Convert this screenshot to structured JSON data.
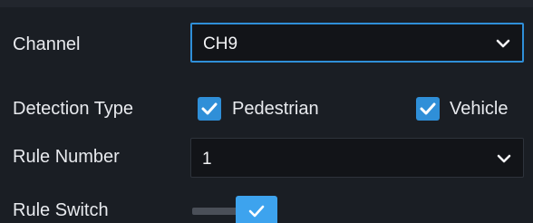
{
  "channel": {
    "label": "Channel",
    "selected_value": "CH9",
    "dropdown_icon": "chevron-down-icon"
  },
  "detection_type": {
    "label": "Detection Type",
    "options": [
      {
        "label": "Pedestrian",
        "checked": true,
        "icon": "checkmark-icon"
      },
      {
        "label": "Vehicle",
        "checked": true,
        "icon": "checkmark-icon"
      }
    ]
  },
  "rule_number": {
    "label": "Rule Number",
    "selected_value": "1",
    "dropdown_icon": "chevron-down-icon"
  },
  "rule_switch": {
    "label": "Rule Switch",
    "enabled": true,
    "icon": "checkmark-icon"
  },
  "colors": {
    "background": "#1a1e24",
    "accent": "#2f8fd8",
    "text": "#e8eaee"
  }
}
